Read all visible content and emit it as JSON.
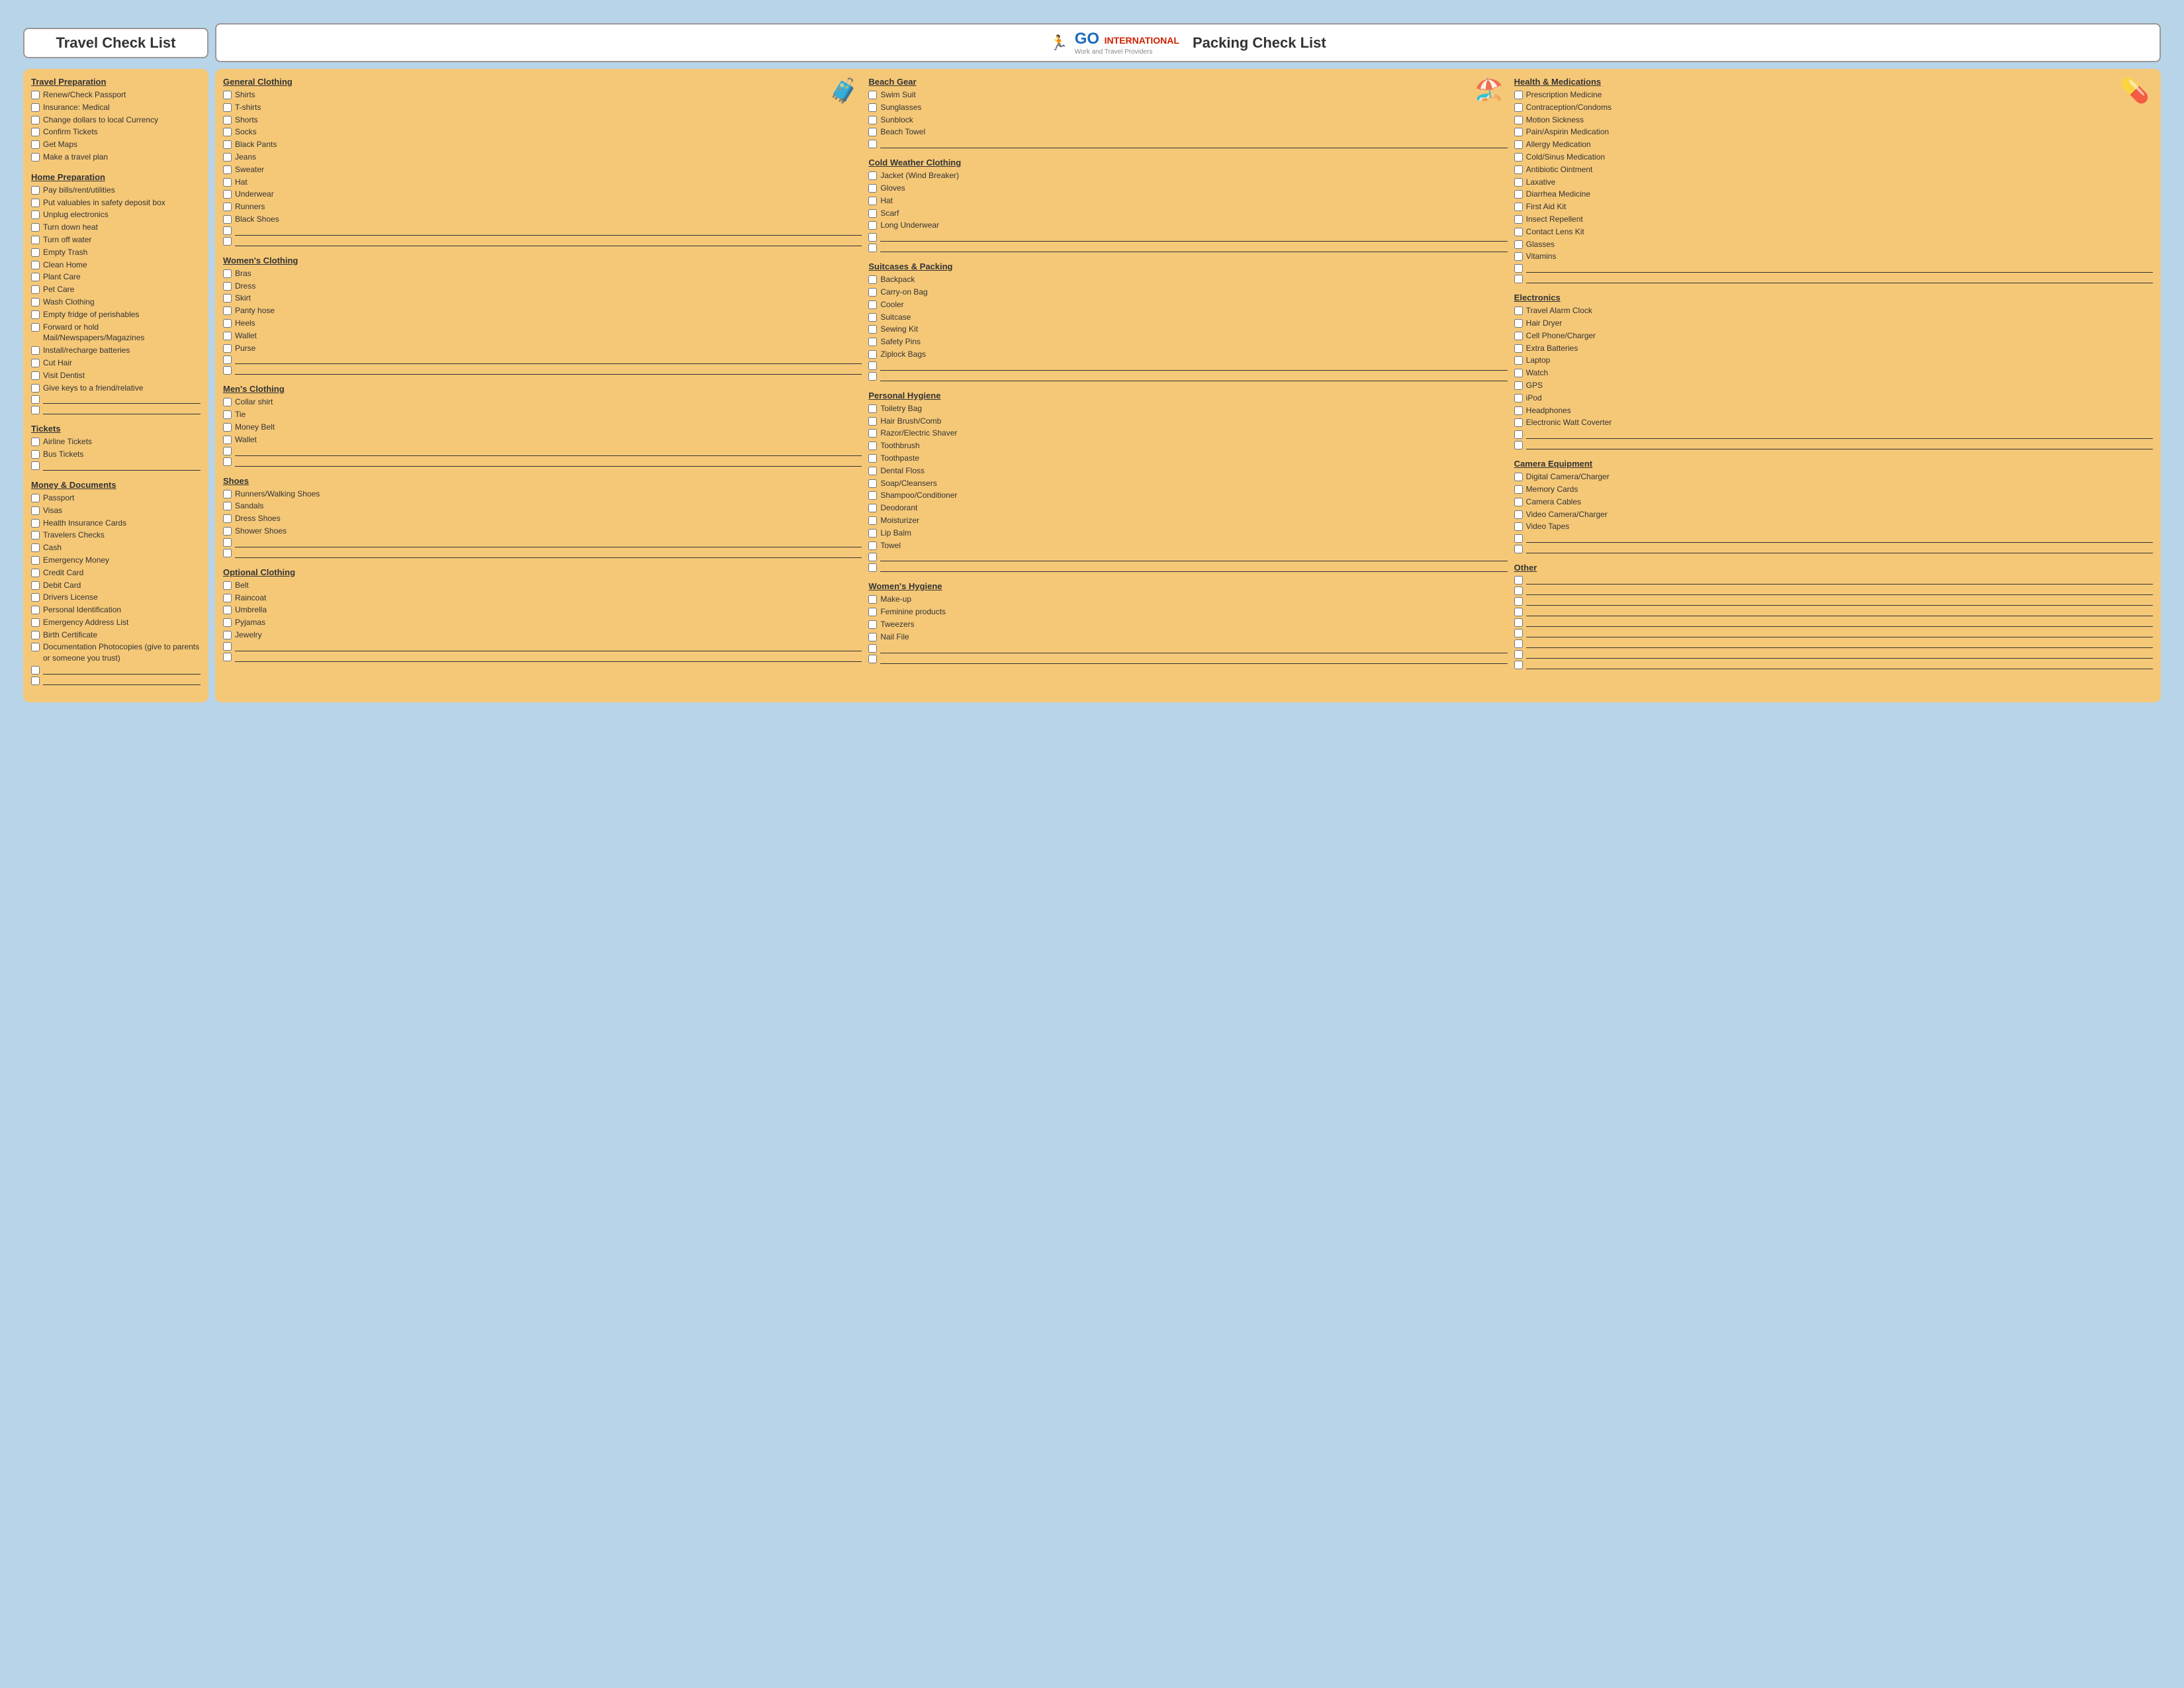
{
  "header": {
    "travel_title": "Travel Check List",
    "logo_icon": "🏃",
    "logo_go": "GO",
    "logo_international": "INTERNATIONAL",
    "logo_sub": "Work and Travel Providers",
    "packing_title": "Packing Check List"
  },
  "travel_preparation": {
    "title": "Travel Preparation",
    "items": [
      "Renew/Check Passport",
      "Insurance: Medical",
      "Change dollars to local Currency",
      "Confirm Tickets",
      "Get Maps",
      "Make a travel plan"
    ]
  },
  "home_preparation": {
    "title": "Home Preparation",
    "items": [
      "Pay bills/rent/utilities",
      "Put valuables in safety deposit box",
      "Unplug electronics",
      "Turn down heat",
      "Turn off water",
      "Empty Trash",
      "Clean Home",
      "Plant Care",
      "Pet Care",
      "Wash Clothing",
      "Empty fridge of perishables",
      "Forward or hold Mail/Newspapers/Magazines",
      "Install/recharge batteries",
      "Cut Hair",
      "Visit Dentist",
      "Give keys to a friend/relative"
    ]
  },
  "tickets": {
    "title": "Tickets",
    "items": [
      "Airline Tickets",
      "Bus Tickets"
    ]
  },
  "money_documents": {
    "title": "Money & Documents",
    "items": [
      "Passport",
      "Visas",
      "Health Insurance Cards",
      "Travelers Checks",
      "Cash",
      "Emergency Money",
      "Credit Card",
      "Debit Card",
      "Drivers License",
      "Personal Identification",
      "Emergency Address List",
      "Birth Certificate",
      "Documentation Photocopies (give to parents or someone you trust)"
    ]
  },
  "general_clothing": {
    "title": "General Clothing",
    "items": [
      "Shirts",
      "T-shirts",
      "Shorts",
      "Socks",
      "Black Pants",
      "Jeans",
      "Sweater",
      "Hat",
      "Underwear",
      "Runners",
      "Black Shoes"
    ]
  },
  "womens_clothing": {
    "title": "Women's Clothing",
    "items": [
      "Bras",
      "Dress",
      "Skirt",
      "Panty hose",
      "Heels",
      "Wallet",
      "Purse"
    ]
  },
  "mens_clothing": {
    "title": "Men's Clothing",
    "items": [
      "Collar shirt",
      "Tie",
      "Money Belt",
      "Wallet"
    ]
  },
  "shoes": {
    "title": "Shoes",
    "items": [
      "Runners/Walking Shoes",
      "Sandals",
      "Dress Shoes",
      "Shower Shoes"
    ]
  },
  "optional_clothing": {
    "title": "Optional Clothing",
    "items": [
      "Belt",
      "Raincoat",
      "Umbrella",
      "Pyjamas",
      "Jewelry"
    ]
  },
  "beach_gear": {
    "title": "Beach Gear",
    "items": [
      "Swim Suit",
      "Sunglasses",
      "Sunblock",
      "Beach Towel"
    ]
  },
  "cold_weather": {
    "title": "Cold Weather Clothing",
    "items": [
      "Jacket (Wind Breaker)",
      "Gloves",
      "Hat",
      "Scarf",
      "Long Underwear"
    ]
  },
  "suitcases_packing": {
    "title": "Suitcases & Packing",
    "items": [
      "Backpack",
      "Carry-on Bag",
      "Cooler",
      "Suitcase",
      "Sewing Kit",
      "Safety Pins",
      "Ziplock Bags"
    ]
  },
  "personal_hygiene": {
    "title": "Personal Hygiene",
    "items": [
      "Toiletry Bag",
      "Hair Brush/Comb",
      "Razor/Electric Shaver",
      "Toothbrush",
      "Toothpaste",
      "Dental Floss",
      "Soap/Cleansers",
      "Shampoo/Conditioner",
      "Deodorant",
      "Moisturizer",
      "Lip Balm",
      "Towel"
    ]
  },
  "womens_hygiene": {
    "title": "Women's Hygiene",
    "items": [
      "Make-up",
      "Feminine products",
      "Tweezers",
      "Nail File"
    ]
  },
  "health_medications": {
    "title": "Health & Medications",
    "items": [
      "Prescription Medicine",
      "Contraception/Condoms",
      "Motion Sickness",
      "Pain/Aspirin Medication",
      "Allergy Medication",
      "Cold/Sinus Medication",
      "Antibiotic Ointment",
      "Laxative",
      "Diarrhea Medicine",
      "First Aid Kit",
      "Insect Repellent",
      "Contact Lens Kit",
      "Glasses",
      "Vitamins"
    ]
  },
  "electronics": {
    "title": "Electronics",
    "items": [
      "Travel Alarm Clock",
      "Hair Dryer",
      "Cell Phone/Charger",
      "Extra Batteries",
      "Laptop",
      "Watch",
      "GPS",
      "iPod",
      "Headphones",
      "Electronic Watt Coverter"
    ]
  },
  "camera_equipment": {
    "title": "Camera Equipment",
    "items": [
      "Digital Camera/Charger",
      "Memory Cards",
      "Camera Cables",
      "Video Camera/Charger",
      "Video Tapes"
    ]
  },
  "other": {
    "title": "Other"
  }
}
